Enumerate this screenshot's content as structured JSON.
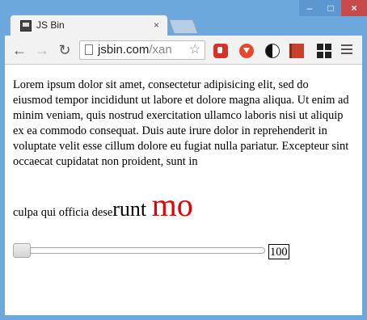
{
  "window": {
    "tab_title": "JS Bin",
    "tab_close": "×",
    "controls": {
      "minimize": "–",
      "maximize": "□",
      "close": "×"
    }
  },
  "toolbar": {
    "back": "←",
    "forward": "→",
    "reload": "↻",
    "url_host": "jsbin.com",
    "url_path": "/xan",
    "star": "☆"
  },
  "content": {
    "paragraph": "Lorem ipsum dolor sit amet, consectetur adipisicing elit, sed do eiusmod tempor incididunt ut labore et dolore magna aliqua. Ut enim ad minim veniam, quis nostrud exercitation ullamco laboris nisi ut aliquip ex ea commodo consequat. Duis aute irure dolor in reprehenderit in voluptate velit esse cillum dolore eu fugiat nulla pariatur. Excepteur sint occaecat cupidatat non proident, sunt in",
    "tail_small": "culpa qui officia dese",
    "tail_medium": "runt ",
    "tail_large": "mo",
    "slider": {
      "min": 0,
      "max": 100,
      "value": 0
    },
    "slider_value_text": "100"
  },
  "colors": {
    "large_text": "#e60000",
    "window_frame": "#6da8dc",
    "close_button": "#c74b4b"
  }
}
